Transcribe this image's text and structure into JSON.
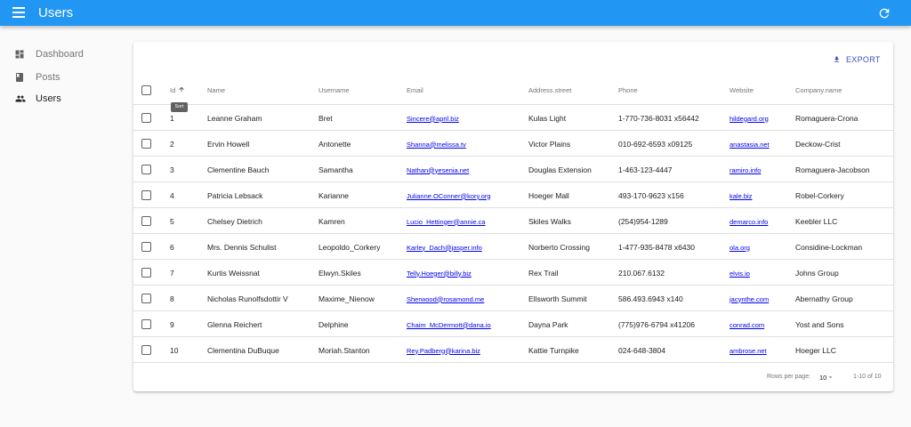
{
  "appbar": {
    "title": "Users"
  },
  "sidebar": {
    "items": [
      {
        "label": "Dashboard",
        "icon": "dashboard-icon"
      },
      {
        "label": "Posts",
        "icon": "book-icon"
      },
      {
        "label": "Users",
        "icon": "people-icon",
        "active": true
      }
    ]
  },
  "toolbar": {
    "export_label": "EXPORT"
  },
  "table": {
    "columns": [
      "Id",
      "Name",
      "Username",
      "Email",
      "Address.street",
      "Phone",
      "Website",
      "Company.name"
    ],
    "sort_tooltip": "Sort",
    "rows": [
      {
        "id": "1",
        "name": "Leanne Graham",
        "username": "Bret",
        "email": "Sincere@april.biz",
        "street": "Kulas Light",
        "phone": "1-770-736-8031 x56442",
        "website": "hildegard.org",
        "company": "Romaguera-Crona"
      },
      {
        "id": "2",
        "name": "Ervin Howell",
        "username": "Antonette",
        "email": "Shanna@melissa.tv",
        "street": "Victor Plains",
        "phone": "010-692-6593 x09125",
        "website": "anastasia.net",
        "company": "Deckow-Crist"
      },
      {
        "id": "3",
        "name": "Clementine Bauch",
        "username": "Samantha",
        "email": "Nathan@yesenia.net",
        "street": "Douglas Extension",
        "phone": "1-463-123-4447",
        "website": "ramiro.info",
        "company": "Romaguera-Jacobson"
      },
      {
        "id": "4",
        "name": "Patricia Lebsack",
        "username": "Karianne",
        "email": "Julianne.OConner@kory.org",
        "street": "Hoeger Mall",
        "phone": "493-170-9623 x156",
        "website": "kale.biz",
        "company": "Robel-Corkery"
      },
      {
        "id": "5",
        "name": "Chelsey Dietrich",
        "username": "Kamren",
        "email": "Lucio_Hettinger@annie.ca",
        "street": "Skiles Walks",
        "phone": "(254)954-1289",
        "website": "demarco.info",
        "company": "Keebler LLC"
      },
      {
        "id": "6",
        "name": "Mrs. Dennis Schulist",
        "username": "Leopoldo_Corkery",
        "email": "Karley_Dach@jasper.info",
        "street": "Norberto Crossing",
        "phone": "1-477-935-8478 x6430",
        "website": "ola.org",
        "company": "Considine-Lockman"
      },
      {
        "id": "7",
        "name": "Kurtis Weissnat",
        "username": "Elwyn.Skiles",
        "email": "Telly.Hoeger@billy.biz",
        "street": "Rex Trail",
        "phone": "210.067.6132",
        "website": "elvis.io",
        "company": "Johns Group"
      },
      {
        "id": "8",
        "name": "Nicholas Runolfsdottir V",
        "username": "Maxime_Nienow",
        "email": "Sherwood@rosamond.me",
        "street": "Ellsworth Summit",
        "phone": "586.493.6943 x140",
        "website": "jacynthe.com",
        "company": "Abernathy Group"
      },
      {
        "id": "9",
        "name": "Glenna Reichert",
        "username": "Delphine",
        "email": "Chaim_McDermott@dana.io",
        "street": "Dayna Park",
        "phone": "(775)976-6794 x41206",
        "website": "conrad.com",
        "company": "Yost and Sons"
      },
      {
        "id": "10",
        "name": "Clementina DuBuque",
        "username": "Moriah.Stanton",
        "email": "Rey.Padberg@karina.biz",
        "street": "Kattie Turnpike",
        "phone": "024-648-3804",
        "website": "ambrose.net",
        "company": "Hoeger LLC"
      }
    ]
  },
  "pagination": {
    "rows_per_page_label": "Rows per page:",
    "rows_per_page": "10",
    "range": "1-10 of 10"
  },
  "colors": {
    "appbar": "#2196f3",
    "export": "#3f51b5",
    "link": "#0000ee"
  }
}
